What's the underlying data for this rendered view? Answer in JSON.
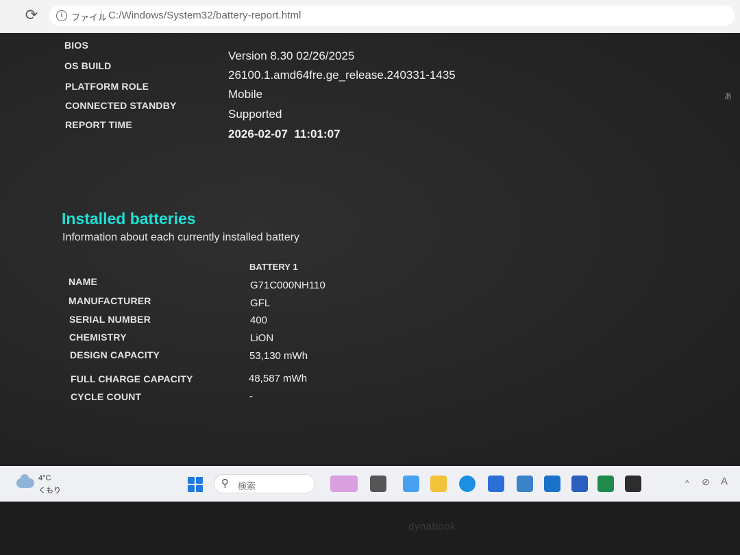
{
  "browser": {
    "scheme_label": "ファイル",
    "url": "C:/Windows/System32/battery-report.html",
    "ime_indicator": "あ"
  },
  "system_info": [
    {
      "key": "BIOS",
      "value": "Version 8.30 02/26/2025"
    },
    {
      "key": "OS BUILD",
      "value": "26100.1.amd64fre.ge_release.240331-1435"
    },
    {
      "key": "PLATFORM ROLE",
      "value": "Mobile"
    },
    {
      "key": "CONNECTED STANDBY",
      "value": "Supported"
    },
    {
      "key": "REPORT TIME",
      "value": "2026-02-07  11:01:07"
    }
  ],
  "installed_batteries": {
    "title": "Installed batteries",
    "description": "Information about each currently installed battery",
    "column_header": "BATTERY 1",
    "rows": [
      {
        "key": "NAME",
        "value": "G71C000NH110"
      },
      {
        "key": "MANUFACTURER",
        "value": "GFL"
      },
      {
        "key": "SERIAL NUMBER",
        "value": "400"
      },
      {
        "key": "CHEMISTRY",
        "value": "LiON"
      },
      {
        "key": "DESIGN CAPACITY",
        "value": "53,130 mWh"
      },
      {
        "key": "FULL CHARGE CAPACITY",
        "value": "48,587 mWh"
      },
      {
        "key": "CYCLE COUNT",
        "value": "-"
      }
    ]
  },
  "taskbar": {
    "weather_temp": "4°C",
    "weather_condition": "くもり",
    "search_placeholder": "検索",
    "apps": [
      {
        "icon": "widgets-icon",
        "color": "#d9a0e0"
      },
      {
        "icon": "file-explorer-icon",
        "color": "#555555"
      },
      {
        "icon": "copilot-icon",
        "color": "#4aa0f0"
      },
      {
        "icon": "folder-icon",
        "color": "#f2c23a"
      },
      {
        "icon": "edge-icon",
        "color": "#1b8fe0"
      },
      {
        "icon": "store-icon",
        "color": "#2a6fd6"
      },
      {
        "icon": "remote-desktop-icon",
        "color": "#3a83c9"
      },
      {
        "icon": "outlook-icon",
        "color": "#1a73c8"
      },
      {
        "icon": "word-icon",
        "color": "#2b5fbf"
      },
      {
        "icon": "excel-icon",
        "color": "#1f8a4c"
      },
      {
        "icon": "terminal-icon",
        "color": "#2d2d2d"
      }
    ],
    "tray": {
      "chevron": "^",
      "font_indicator": "A"
    }
  },
  "bezel": {
    "brand": "dynabook"
  }
}
